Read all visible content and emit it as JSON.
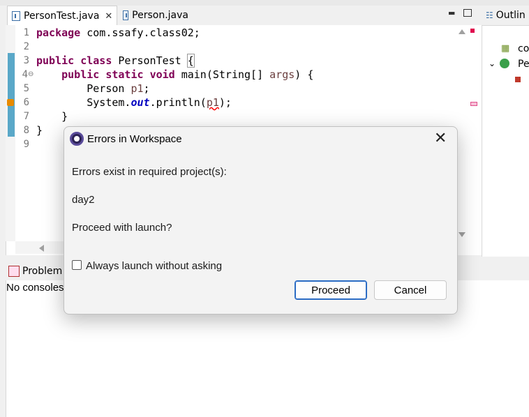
{
  "editor": {
    "tabs": [
      {
        "label": "PersonTest.java",
        "active": true
      },
      {
        "label": "Person.java",
        "active": false
      }
    ],
    "line_numbers": [
      "1",
      "2",
      "3",
      "4",
      "5",
      "6",
      "7",
      "8",
      "9"
    ],
    "line4_fold_marker": "⊖"
  },
  "code": {
    "line1": {
      "kw": "package",
      "rest": " com.ssafy.class02;"
    },
    "line3": {
      "kw1": "public",
      "kw2": "class",
      "rest": " PersonTest ",
      "brace": "{"
    },
    "line4": {
      "indent": "    ",
      "kw1": "public",
      "kw2": "static",
      "kw3": "void",
      "rest1": " main(String[] ",
      "param": "args",
      "rest2": ") {"
    },
    "line5": {
      "indent": "        ",
      "type": "Person ",
      "var": "p1",
      "rest": ";"
    },
    "line6": {
      "indent": "        ",
      "obj": "System.",
      "field": "out",
      "call": ".println(",
      "arg": "p1",
      "rest": ");"
    },
    "line7": "    }",
    "line8": "}"
  },
  "outline": {
    "tab_label": "Outlin",
    "items": [
      "co",
      "Pe"
    ]
  },
  "bottom": {
    "tab_label": "Problem",
    "console_text": "No consoles"
  },
  "dialog": {
    "title": "Errors in Workspace",
    "message": "Errors exist in required project(s):",
    "project": "day2",
    "question": "Proceed with launch?",
    "checkbox_label": "Always launch without asking",
    "checkbox_checked": false,
    "proceed_label": "Proceed",
    "cancel_label": "Cancel",
    "close_glyph": "✕"
  },
  "colors": {
    "keyword": "#7f0055",
    "field": "#0000c0",
    "error": "#e0004c",
    "change_bar": "#5aa8c8",
    "button_focus": "#2b6cc4"
  }
}
